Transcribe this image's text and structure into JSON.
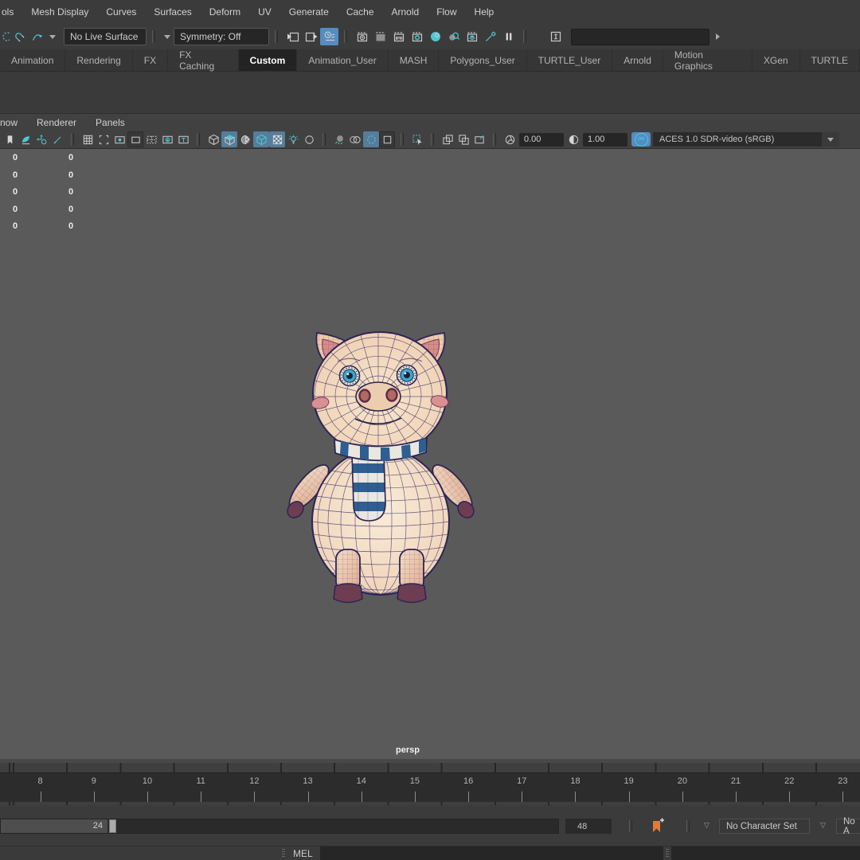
{
  "colors": {
    "accent_teal": "#4ec7d3",
    "active_blue": "#567d9b",
    "history_active_blue": "#548cc4",
    "viewport_bg": "#5a5a5a",
    "bookmark_orange": "#e4793c"
  },
  "menu_bar": {
    "items": [
      "ols",
      "Mesh Display",
      "Curves",
      "Surfaces",
      "Deform",
      "UV",
      "Generate",
      "Cache",
      "Arnold",
      "Flow",
      "Help"
    ]
  },
  "status_line": {
    "live_surface_value": "No Live Surface",
    "symmetry_value": "Symmetry: Off",
    "ipr_label": "IPR",
    "command_value": ""
  },
  "shelf": {
    "tabs": [
      "Animation",
      "Rendering",
      "FX",
      "FX Caching",
      "Custom",
      "Animation_User",
      "MASH",
      "Polygons_User",
      "TURTLE_User",
      "Arnold",
      "Motion Graphics",
      "XGen",
      "TURTLE"
    ],
    "active_tab": "Custom"
  },
  "panel_menu": {
    "items": [
      "now",
      "Renderer",
      "Panels"
    ]
  },
  "viewport_bar": {
    "exposure_value": "0.00",
    "gamma_value": "1.00",
    "on_label": "ON",
    "color_space": "ACES 1.0 SDR-video (sRGB)"
  },
  "viewport": {
    "camera_label": "persp",
    "hud_left": [
      "0",
      "0",
      "0",
      "0",
      "0"
    ],
    "hud_right": [
      "0",
      "0",
      "0",
      "0",
      "0"
    ]
  },
  "timeline": {
    "frames": [
      "8",
      "9",
      "10",
      "11",
      "12",
      "13",
      "14",
      "15",
      "16",
      "17",
      "18",
      "19",
      "20",
      "21",
      "22",
      "23"
    ]
  },
  "range_row": {
    "range_value": "24",
    "end_time_value": "48",
    "character_set_value": "No Character Set",
    "anim_layer_value": "No A"
  },
  "command_line": {
    "language_label": "MEL"
  }
}
